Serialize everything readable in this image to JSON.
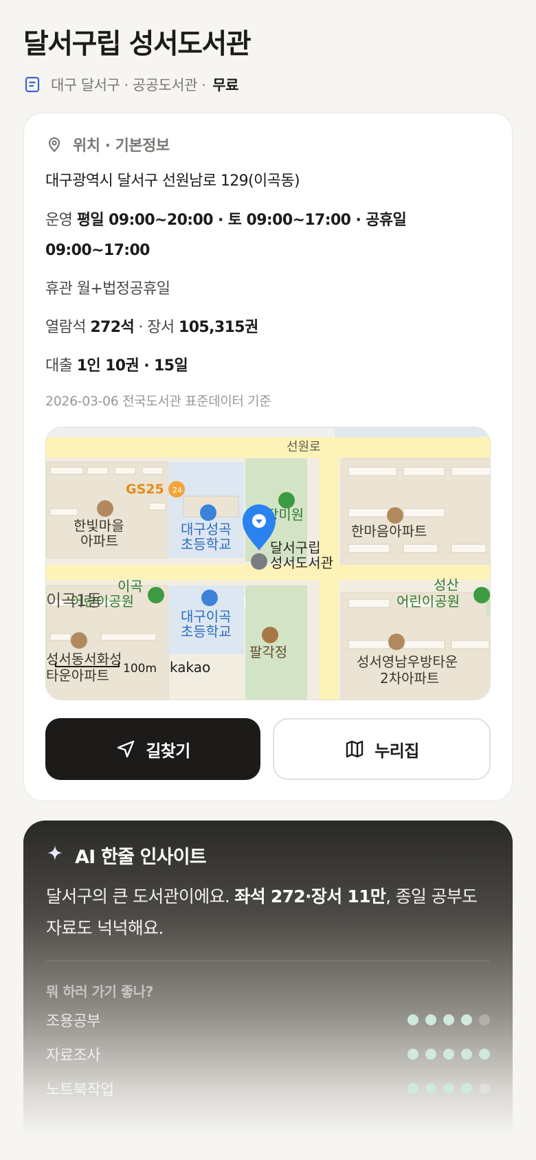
{
  "header": {
    "title": "달서구립 성서도서관",
    "meta_region": "대구 달서구 · 공공도서관 ·",
    "meta_fee": "무료"
  },
  "info": {
    "section_label": "위치 · 기본정보",
    "address": "대구광역시 달서구 선원남로 129(이곡동)",
    "hours_label": "운영",
    "hours_value": "평일 09:00~20:00 · 토 09:00~17:00 · 공휴일 09:00~17:00",
    "closed_label": "휴관",
    "closed_value": "월+법정공휴일",
    "seats_label": "열람석",
    "seats_value": "272석",
    "books_label": "· 장서",
    "books_value": "105,315권",
    "loan_label": "대출",
    "loan_value": "1인 10권 · 15일",
    "reference": "2026-03-06 전국도서관 표준데이터 기준"
  },
  "map": {
    "labels": {
      "road": "선원로",
      "gs25": "GS25",
      "hanbit_1": "한빛마을",
      "hanbit_2": "아파트",
      "school1_1": "대구성곡",
      "school1_2": "초등학교",
      "jangmi": "장미원",
      "lib_1": "달서구립",
      "lib_2": "성서도서관",
      "hanmaeum": "한마음아파트",
      "park1_1": "이곡",
      "park1_2": "어린이공원",
      "igok": "이곡1동",
      "school2_1": "대구이곡",
      "school2_2": "초등학교",
      "seongsan_1": "성산",
      "seongsan_2": "어린이공원",
      "palgak": "팔각정",
      "seongseo": "성서동서화성",
      "seongseo_2": "타운아파트",
      "youngnam_1": "성서영남우방타운",
      "youngnam_2": "2차아파트",
      "scale": "100m",
      "brand": "kakao"
    },
    "colors": {
      "base": "#f2ede1",
      "road": "#fdf3b8",
      "green": "#d3e4c6",
      "school": "#dde7f2",
      "marker": "#2a82f0"
    }
  },
  "buttons": {
    "directions": "길찾기",
    "nurijip": "누리집"
  },
  "ai": {
    "title": "AI 한줄 인사이트",
    "text_1": "달서구의 큰 도서관이에요. ",
    "text_bold": "좌석 272·장서 11만",
    "text_2": ", 종일 공부도 자료도 넉넉해요.",
    "sub_title": "뭐 하러 가기 좋나?",
    "ratings": [
      {
        "label": "조용공부",
        "score": 4,
        "max": 5
      },
      {
        "label": "자료조사",
        "score": 5,
        "max": 5
      },
      {
        "label": "노트북작업",
        "score": 4,
        "max": 5
      }
    ]
  }
}
